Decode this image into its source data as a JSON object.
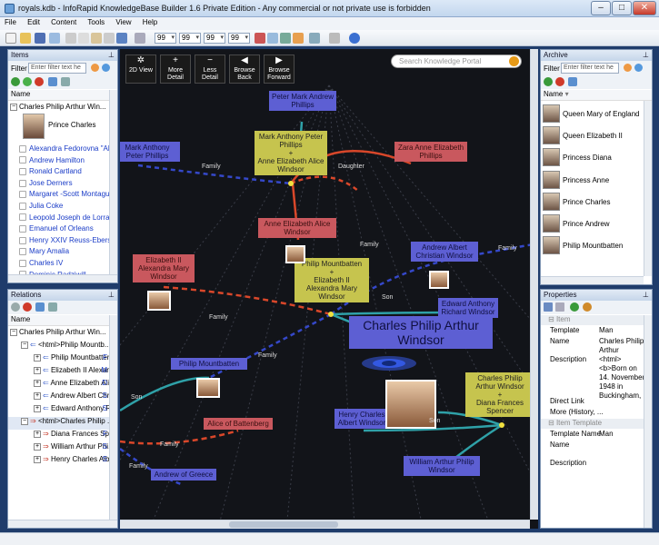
{
  "window": {
    "title": "royals.kdb - InfoRapid KnowledgeBase Builder 1.6 Private Edition - Any commercial or not private use is forbidden"
  },
  "menu": [
    "File",
    "Edit",
    "Content",
    "Tools",
    "View",
    "Help"
  ],
  "toolbar": {
    "depth_values": [
      "99",
      "99",
      "99",
      "99"
    ]
  },
  "items_panel": {
    "header": "Items",
    "filter_label": "Filter",
    "filter_placeholder": "Enter filter text he",
    "col_header": "Name",
    "root": "Charles Philip Arthur Win...",
    "child": "Prince Charles",
    "rows": [
      "Alexandra Fedorovna \"Alix\"",
      "Andrew Hamilton",
      "Ronald Cartland",
      "Jose Derners",
      "Margaret -Scott Montagu...",
      "Julia Coke",
      "Leopold Joseph de Lorraine",
      "Emanuel of Orleans",
      "Henry XXIV Reuss-Ebersd...",
      "Mary Amalia",
      "Charles IV",
      "Dominic Radziwill"
    ]
  },
  "relations_panel": {
    "header": "Relations",
    "col_header": "Name",
    "col_header2": "R",
    "root": "Charles Philip Arthur Win...",
    "group1": "<html>Philip Mountb...",
    "group1_code": "S",
    "group1_items": [
      "Philip Mountbatten",
      "Elizabeth II Alexan...",
      "Anne Elizabeth Ali...",
      "Andrew Albert Chr...",
      "Edward Anthony Ri..."
    ],
    "group1_codes": [
      "F",
      "M",
      "D",
      "S",
      "S"
    ],
    "group2": "<html>Charles Philip ...",
    "group2_code": "S",
    "group2_items": [
      "Diana Frances Spe...",
      "William Arthur Phi...",
      "Henry Charles Alb..."
    ],
    "group2_codes": [
      "F",
      "S",
      "S"
    ]
  },
  "graph": {
    "search_placeholder": "Search Knowledge Portal",
    "nav": [
      {
        "glyph": "✲",
        "label": "2D View"
      },
      {
        "glyph": "+",
        "label": "More Detail"
      },
      {
        "glyph": "−",
        "label": "Less Detail"
      },
      {
        "glyph": "◀",
        "label": "Browse Back"
      },
      {
        "glyph": "▶",
        "label": "Browse Forward"
      }
    ],
    "nodes": {
      "peter": "Peter Mark Andrew Phillips",
      "mark_anne": "Mark Anthony Peter Phillips\n+\nAnne Elizabeth Alice Windsor",
      "mark_left": "Mark Anthony Peter Phillips",
      "zara": "Zara Anne Elizabeth Phillips",
      "anne": "Anne Elizabeth Alice Windsor",
      "elizabeth": "Elizabeth II Alexandra Mary Windsor",
      "philip_eliz": "Philip Mountbatten\n+\nElizabeth II\nAlexandra Mary\nWindsor",
      "andrew": "Andrew Albert Christian Windsor",
      "edward": "Edward Anthony Richard Windsor",
      "charles": "Charles Philip Arthur Windsor",
      "philip": "Philip Mountbatten",
      "charles_diana": "Charles Philip Arthur Windsor\n+\nDiana Frances Spencer",
      "alice": "Alice of Battenberg",
      "henry": "Henry Charles Albert Windsor",
      "william": "William Arthur Philip Windsor",
      "andrew_greece": "Andrew of Greece"
    },
    "edge_labels": [
      "Family",
      "Daughter",
      "Family",
      "Family",
      "Son",
      "Family",
      "Son",
      "Family",
      "Son",
      "Family",
      "Family"
    ]
  },
  "archive_panel": {
    "header": "Archive",
    "filter_label": "Filter",
    "filter_placeholder": "Enter filter text he",
    "col_header": "Name",
    "rows": [
      "Queen Mary of England",
      "Queen Elizabeth II",
      "Princess Diana",
      "Princess Anne",
      "Prince Charles",
      "Prince Andrew",
      "Philip Mountbatten"
    ]
  },
  "properties_panel": {
    "header": "Properties",
    "cat_item": "Item",
    "props": [
      {
        "k": "Template",
        "v": "Man"
      },
      {
        "k": "Name",
        "v": "Charles Philip Arthur"
      },
      {
        "k": "Description",
        "v": "<html> <b>Born on 14. November 1948 in Buckingham,"
      },
      {
        "k": "Direct Link",
        "v": ""
      },
      {
        "k": "More (History, ...",
        "v": ""
      }
    ],
    "cat_template": "Item Template",
    "tprops": [
      {
        "k": "Template Name",
        "v": "Man"
      },
      {
        "k": "Name",
        "v": ""
      },
      {
        "k": "Description",
        "v": ""
      }
    ]
  },
  "colors": {
    "node_blue": "#5d5fd3",
    "node_red": "#c9585e",
    "node_yellow": "#c6c44e",
    "canvas": "#121419",
    "link": "#1a3cc7"
  }
}
